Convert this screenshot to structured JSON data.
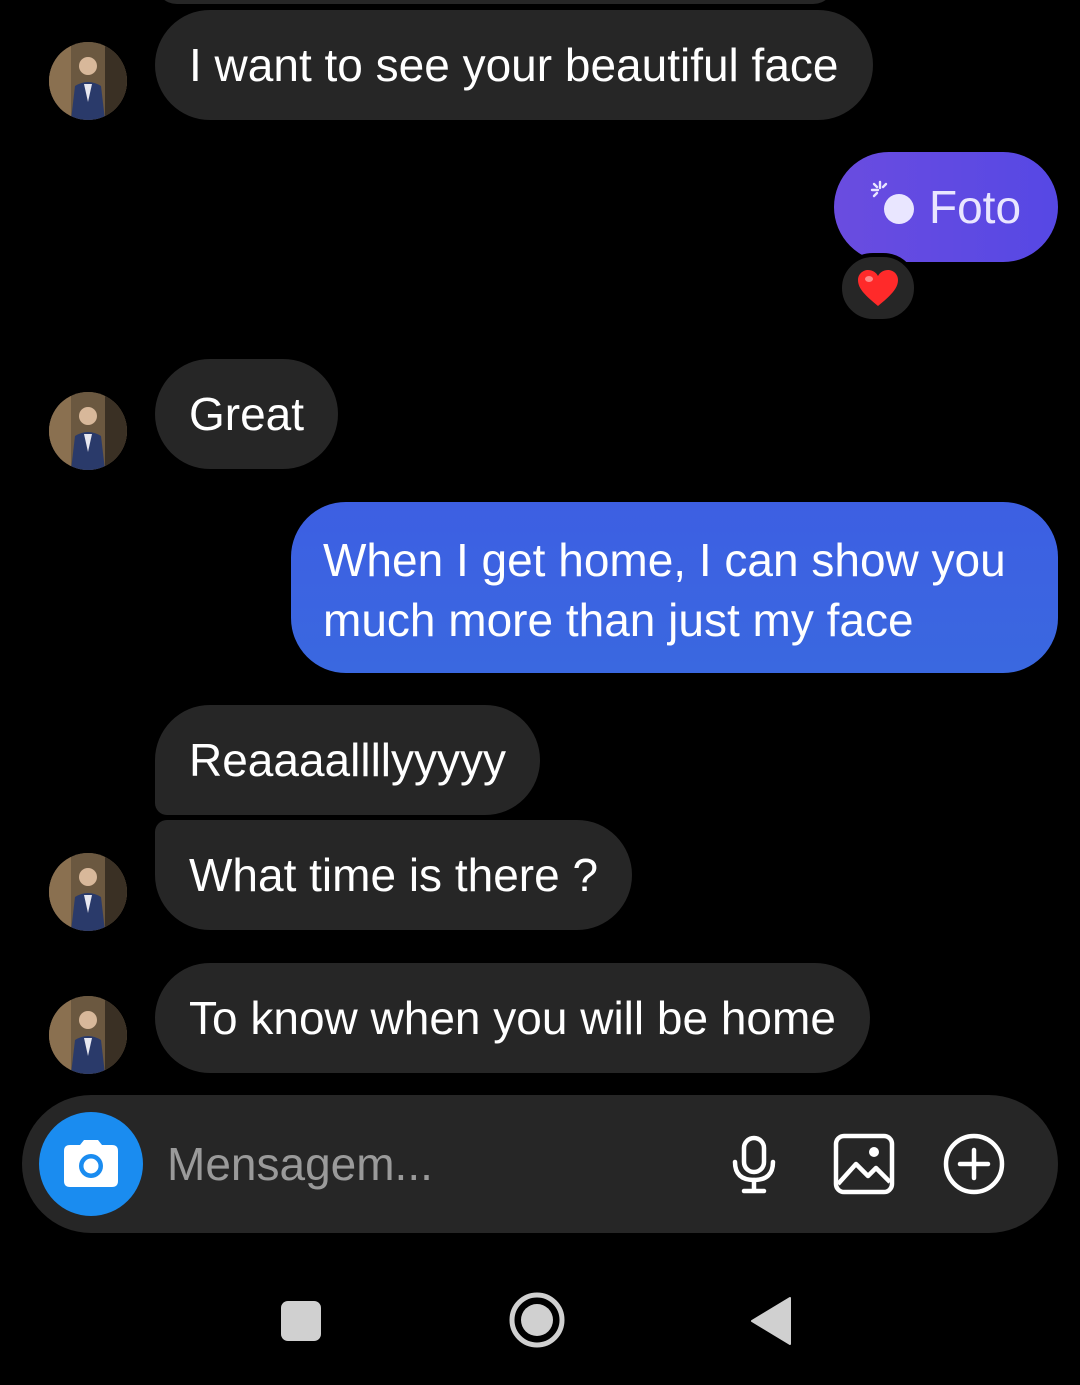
{
  "conversation": {
    "messages": [
      {
        "side": "incoming",
        "text": "I want to see your beautiful face"
      },
      {
        "side": "outgoing",
        "type": "photo",
        "text": "Foto",
        "reaction": "heart"
      },
      {
        "side": "incoming",
        "text": "Great"
      },
      {
        "side": "outgoing",
        "text": "When I get home, I can show you much more than just my face"
      },
      {
        "side": "incoming",
        "text": "Reaaaallllyyyyy"
      },
      {
        "side": "incoming",
        "text": "What time is there ?"
      },
      {
        "side": "incoming",
        "text": "To know when you will be home"
      }
    ]
  },
  "composer": {
    "placeholder": "Mensagem...",
    "icons": [
      "camera-icon",
      "microphone-icon",
      "gallery-icon",
      "plus-circle-icon"
    ]
  },
  "navigation": {
    "icons": [
      "recent-apps-icon",
      "home-icon",
      "back-icon"
    ]
  },
  "colors": {
    "background": "#000000",
    "incoming_bubble": "#262626",
    "outgoing_gradient_top": "#6a4ce0",
    "outgoing_gradient_bottom": "#3a62e0",
    "camera_button": "#1a8cf0",
    "reaction_heart": "#ff2a2a"
  }
}
